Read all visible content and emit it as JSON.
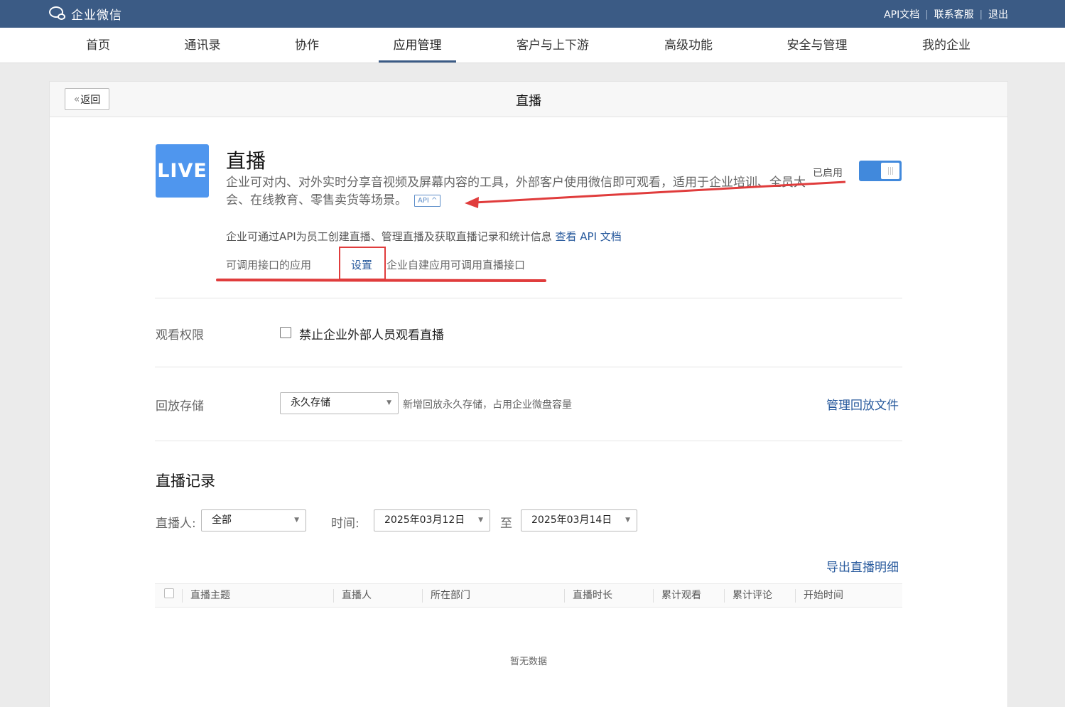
{
  "topbar": {
    "logo_text": "企业微信",
    "links": [
      "API文档",
      "联系客服",
      "退出"
    ],
    "separator": "|"
  },
  "nav": {
    "items": [
      "首页",
      "通讯录",
      "协作",
      "应用管理",
      "客户与上下游",
      "高级功能",
      "安全与管理",
      "我的企业"
    ],
    "active": "应用管理"
  },
  "page": {
    "back_label": "返回",
    "back_chevron": "«",
    "title": "直播"
  },
  "app": {
    "icon_text": "LIVE",
    "name": "直播",
    "description": "企业可对内、对外实时分享音视频及屏幕内容的工具，外部客户使用微信即可观看，适用于企业培训、全员大会、在线教育、零售卖货等场景。",
    "api_tag": "API ^",
    "status_label": "已启用",
    "enabled": true,
    "api_info": "企业可通过API为员工创建直播、管理直播及获取直播记录和统计信息",
    "api_doc_link": "查看 API 文档",
    "api_apps_label": "可调用接口的应用",
    "api_apps_set": "设置",
    "api_apps_note": "企业自建应用可调用直播接口"
  },
  "watch_permission": {
    "label": "观看权限",
    "checkbox_label": "禁止企业外部人员观看直播",
    "checked": false
  },
  "playback_storage": {
    "label": "回放存储",
    "selected": "永久存储",
    "note": "新增回放永久存储，占用企业微盘容量",
    "manage_link": "管理回放文件"
  },
  "records": {
    "title": "直播记录",
    "host_label": "直播人:",
    "host_selected": "全部",
    "time_label": "时间:",
    "start_date": "2025年03月12日",
    "to_label": "至",
    "end_date": "2025年03月14日",
    "export_link": "导出直播明细",
    "columns": [
      "直播主题",
      "直播人",
      "所在部门",
      "直播时长",
      "累计观看",
      "累计评论",
      "开始时间"
    ],
    "empty_text": "暂无数据"
  },
  "colors": {
    "topbar": "#3b5b85",
    "link": "#285a9d",
    "app_icon": "#4f96ee",
    "toggle": "#4189dc",
    "annotation": "#e03c3c"
  }
}
